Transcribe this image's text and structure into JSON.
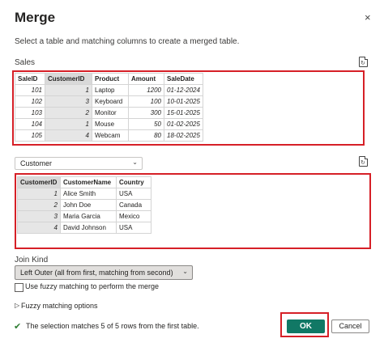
{
  "dialog": {
    "title": "Merge",
    "close_glyph": "×",
    "subtitle": "Select a table and matching columns to create a merged table."
  },
  "sales": {
    "label": "Sales",
    "icon": "page-refresh-icon",
    "columns": [
      "SaleID",
      "CustomerID",
      "Product",
      "Amount",
      "SaleDate"
    ],
    "rows": [
      [
        "101",
        "1",
        "Laptop",
        "1200",
        "01-12-2024"
      ],
      [
        "102",
        "3",
        "Keyboard",
        "100",
        "10-01-2025"
      ],
      [
        "103",
        "2",
        "Monitor",
        "300",
        "15-01-2025"
      ],
      [
        "104",
        "1",
        "Mouse",
        "50",
        "01-02-2025"
      ],
      [
        "105",
        "4",
        "Webcam",
        "80",
        "18-02-2025"
      ]
    ]
  },
  "customer": {
    "selected_table": "Customer",
    "icon": "page-refresh-icon",
    "columns": [
      "CustomerID",
      "CustomerName",
      "Country"
    ],
    "rows": [
      [
        "1",
        "Alice Smith",
        "USA"
      ],
      [
        "2",
        "John Doe",
        "Canada"
      ],
      [
        "3",
        "Maria Garcia",
        "Mexico"
      ],
      [
        "4",
        "David Johnson",
        "USA"
      ]
    ]
  },
  "join": {
    "label": "Join Kind",
    "selected": "Left Outer (all from first, matching from second)",
    "fuzzy_checkbox_label": "Use fuzzy matching to perform the merge",
    "fuzzy_options_label": "Fuzzy matching options"
  },
  "status": {
    "text": "The selection matches 5 of 5 rows from the first table.",
    "icon": "checkmark-icon"
  },
  "buttons": {
    "ok": "OK",
    "cancel": "Cancel"
  },
  "colors": {
    "highlight": "#d62027",
    "ok_button": "#117865",
    "selected_column": "#d9d9d9",
    "check": "#2e7d32"
  }
}
